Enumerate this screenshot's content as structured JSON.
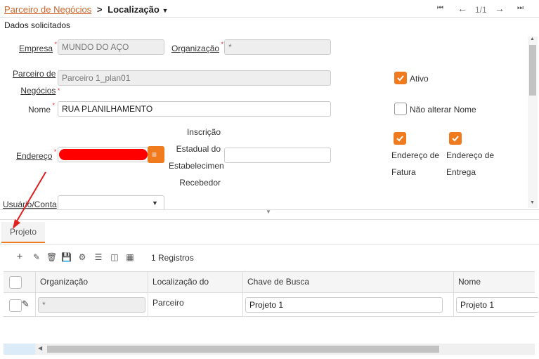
{
  "breadcrumb": {
    "parent": "Parceiro de Negócios",
    "separator": ">",
    "current": "Localização"
  },
  "nav": {
    "page": "1/1"
  },
  "section_title": "Dados solicitados",
  "form": {
    "empresa": {
      "label": "Empresa",
      "value": "MUNDO DO AÇO"
    },
    "organizacao": {
      "label": "Organização",
      "value": "*"
    },
    "parceiro": {
      "label_line1": "Parceiro de",
      "label_line2": "Negócios",
      "value": "Parceiro 1_plan01"
    },
    "ativo": {
      "label": "Ativo",
      "checked": true
    },
    "nome": {
      "label": "Nome",
      "value": "RUA PLANILHAMENTO"
    },
    "nao_alterar_nome": {
      "label": "Não alterar Nome",
      "checked": false
    },
    "endereco": {
      "label": "Endereço",
      "value": ""
    },
    "inscricao": {
      "label_l1": "Inscrição",
      "label_l2": "Estadual do",
      "label_l3": "Estabelecimen",
      "label_l4": "Recebedor",
      "value": ""
    },
    "endereco_fatura": {
      "label_l1": "Endereço de",
      "label_l2": "Fatura",
      "checked": true
    },
    "endereco_entrega": {
      "label_l1": "Endereço de",
      "label_l2": "Entrega",
      "checked": true
    },
    "usuario": {
      "label": "Usuário/Conta",
      "value": ""
    }
  },
  "tabs": [
    {
      "label": "Projeto",
      "active": true
    }
  ],
  "grid": {
    "records": "1 Registros",
    "columns": [
      "Organização",
      "Localização do Parceiro",
      "Chave de Busca",
      "Nome"
    ],
    "rows": [
      {
        "organizacao": "*",
        "localizacao": "",
        "chave": "Projeto 1",
        "nome": "Projeto 1"
      }
    ]
  },
  "colors": {
    "accent": "#f07a1e",
    "link": "#d0662a",
    "annotation": "#e02020",
    "redaction": "#ff0000"
  }
}
